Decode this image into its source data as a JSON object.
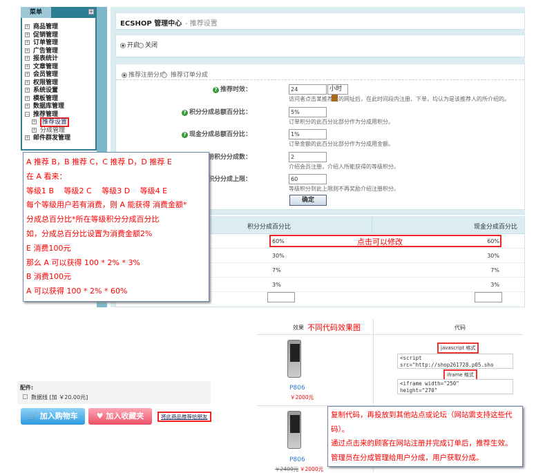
{
  "sidebar": {
    "title": "菜单",
    "items": [
      "商品管理",
      "促销管理",
      "订单管理",
      "广告管理",
      "报表统计",
      "文章管理",
      "会员管理",
      "权限管理",
      "系统设置",
      "模板管理",
      "数据库管理",
      "推荐管理"
    ],
    "sub_items": [
      "推荐设置",
      "分成管理"
    ],
    "last_item": "邮件群发管理"
  },
  "header": {
    "brand": "ECSHOP 管理中心",
    "page": "- 推荐设置"
  },
  "switch": {
    "on": "开启",
    "off": "关闭"
  },
  "mode": {
    "register": "推荐注册分成",
    "order": "推荐订单分成"
  },
  "form": {
    "rows": [
      {
        "label": "推荐时效：",
        "value": "24",
        "desc": "访问者点击某推荐人的网址后，在此时间段内注册、下单，均认为是该推荐人的所介绍的。"
      },
      {
        "label": "积分分成总额百分比：",
        "value": "5%",
        "desc": "订单积分的此百分比部分作为分成用积分。"
      },
      {
        "label": "现金分成总额百分比：",
        "value": "1%",
        "desc": "订单金额的此百分比部分作为分成用金额。"
      },
      {
        "label": "注册积分分成数：",
        "value": "2",
        "desc": "介绍会员注册，介绍人所能获得的等级积分。"
      },
      {
        "label": "等级积分分成上限：",
        "value": "60",
        "desc": "等级积分到此上限则不再奖励介绍注册积分。"
      }
    ],
    "unit": "小时",
    "submit": "确定"
  },
  "table": {
    "headers": [
      "积分分成百分比",
      "现金分成百分比"
    ],
    "rows": [
      [
        "60%",
        "60%"
      ],
      [
        "30%",
        "30%"
      ],
      [
        "7%",
        "7%"
      ],
      [
        "3%",
        "3%"
      ]
    ],
    "note": "点击可以修改"
  },
  "callout1": [
    "A 推荐 B，B 推荐 C，C 推荐 D，D 推荐 E",
    "在 A 看来：",
    "等级1 B　 等级2 C　 等级3 D　 等级4 E",
    "每个等级用户若有消费，则 A 能获得 消费金额*",
    "分成总百分比*所在等级积分分成百分比",
    "如，分成总百分比设置为消费金额2%",
    "E 消费100元",
    "那么 A 可以获得 100 * 2% * 3%",
    "B 消费100元",
    "A 可以获得 100 * 2% * 60%"
  ],
  "accessory": {
    "title": "配件:",
    "item": "数据线 [加 ￥20.00元]"
  },
  "buttons": {
    "cart": "加入购物车",
    "fav": "加入收藏夹",
    "recommend": "将此商品推荐给朋友"
  },
  "code_table": {
    "col_effect": "效果",
    "effect_note": "不同代码效果图",
    "col_code": "代码",
    "js_tag": "javascript 格式",
    "js_code": "<script\nsrc=\"http://shop261728.p05.sho",
    "iframe_tag": "iframe 格式",
    "iframe_code": "<iframe width=\"250\"\nheight=\"270\"",
    "product": "P806",
    "price": "￥2000元",
    "old_price": "￥2400元"
  },
  "callout2": [
    "复制代码，再投放到其他站点或论坛（网站需支持这些代",
    "码）。",
    "通过点击来的顾客在网站注册并完成订单后，推荐生效。",
    "管理员在分成管理给用户分成，用户获取分成。"
  ]
}
